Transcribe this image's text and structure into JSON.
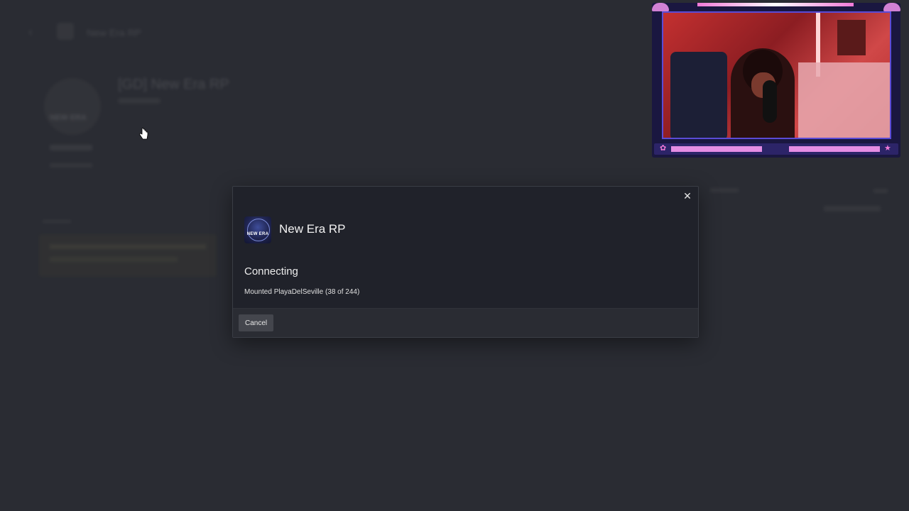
{
  "background": {
    "breadcrumb": "New Era RP",
    "server_title": "[GD] New Era RP",
    "logo_text": "NEW ERA"
  },
  "modal": {
    "logo_text": "NEW ERA",
    "server_name": "New Era RP",
    "status": "Connecting",
    "detail": "Mounted PlayaDelSeville (38 of 244)",
    "cancel_label": "Cancel",
    "close_icon": "close-icon",
    "colors": {
      "background": "#20222a",
      "footer": "#2a2c33",
      "button": "#44464d"
    }
  },
  "webcam": {
    "accent": "#e58de4",
    "frame": "#1a1740"
  }
}
